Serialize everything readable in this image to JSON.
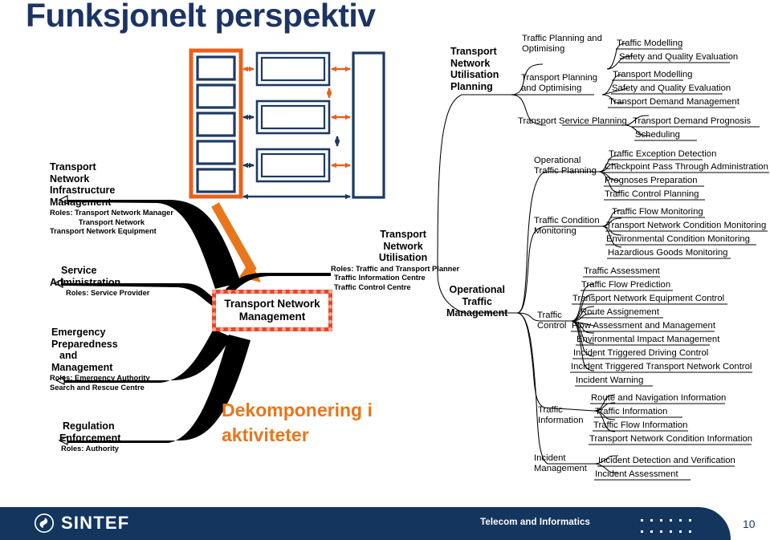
{
  "slide": {
    "title": "Funksjonelt perspektiv",
    "decomposition_caption": "Dekomponering i aktiviteter",
    "center_box_line1": "Transport Network",
    "center_box_line2": "Management",
    "colors": {
      "title_navy": "#1c3464",
      "orange": "#e8761b",
      "red_border": "#e8452c",
      "box_navy": "#1c3a63",
      "footer_navy": "#13355e"
    }
  },
  "diagram": {
    "name": "layered-architecture-diagram",
    "orange_column_boxes": 5,
    "middle_stack_boxes": 3,
    "right_tall_boxes": 1
  },
  "left_branches": [
    {
      "head": [
        "Transport",
        "Network",
        "Infrastructure",
        "Management"
      ],
      "roles": [
        "Roles: Transport Network Manager",
        "Transport Network",
        "Transport Network Equipment"
      ]
    },
    {
      "head": [
        "Service",
        "Administration"
      ],
      "roles": [
        "Roles: Service Provider"
      ]
    },
    {
      "head": [
        "Emergency",
        "Preparedness",
        "and",
        "Management"
      ],
      "roles": [
        "Roles: Emergency Authority",
        "Search and Rescue Centre"
      ]
    },
    {
      "head": [
        "Regulation",
        "Enforcement"
      ],
      "roles": [
        "Roles: Authority"
      ]
    }
  ],
  "center_branches": [
    {
      "head": [
        "Transport",
        "Network",
        "Utilisation"
      ],
      "roles": [
        "Roles: Traffic and Transport Planner",
        "Traffic Information Centre",
        "Traffic Control Centre"
      ]
    },
    {
      "head": [
        "Operational",
        "Traffic",
        "Management"
      ],
      "roles": []
    }
  ],
  "tree": {
    "root_utilisation_planning": [
      "Transport",
      "Network",
      "Utilisation",
      "Planning"
    ],
    "root_operational_management": [
      "Operational",
      "Traffic",
      "Management"
    ],
    "groups": [
      {
        "label": [
          "Traffic Planning and",
          "Optimising"
        ],
        "leaves": [
          "Traffic Modelling",
          "Safety and Quality Evaluation"
        ]
      },
      {
        "label": [
          "Transport Planning",
          "and Optimising"
        ],
        "leaves": [
          "Transport Modelling",
          "Safety and Quality Evaluation",
          "Transport Demand Management"
        ]
      },
      {
        "label": [
          "Transport Service Planning"
        ],
        "leaves": [
          "Transport Demand Prognosis",
          "Scheduling"
        ]
      },
      {
        "label": [
          "Operational",
          "Traffic Planning"
        ],
        "leaves": [
          "Traffic Exception Detection",
          "Checkpoint Pass Through Administration",
          "Prognoses Preparation",
          "Traffic Control Planning"
        ]
      },
      {
        "label": [
          "Traffic Condition",
          "Monitoring"
        ],
        "leaves": [
          "Traffic Flow Monitoring",
          "Transport Network Condition Monitoring",
          "Environmental Condition Monitoring",
          "Hazardious Goods Monitoring"
        ]
      },
      {
        "label": [
          "Traffic",
          "Control"
        ],
        "leaves": [
          "Traffic Assessment",
          "Traffic Flow Prediction",
          "Transport Network Equipment Control",
          "Route Assignement",
          "Flow Assessment and Management",
          "Environmental Impact Management",
          "Incident Triggered Driving Control",
          "Incident Triggered Transport Network Control",
          "Incident Warning"
        ]
      },
      {
        "label": [
          "Traffic",
          "Information"
        ],
        "leaves": [
          "Route and Navigation Information",
          "Traffic Information",
          "Traffic Flow Information",
          "Transport Network Condition Information"
        ]
      },
      {
        "label": [
          "Incident",
          "Management"
        ],
        "leaves": [
          "Incident Detection and Verification",
          "Incident Assessment"
        ]
      }
    ]
  },
  "footer": {
    "brand": "SINTEF",
    "tagline": "Telecom and Informatics",
    "page_number": "10"
  }
}
